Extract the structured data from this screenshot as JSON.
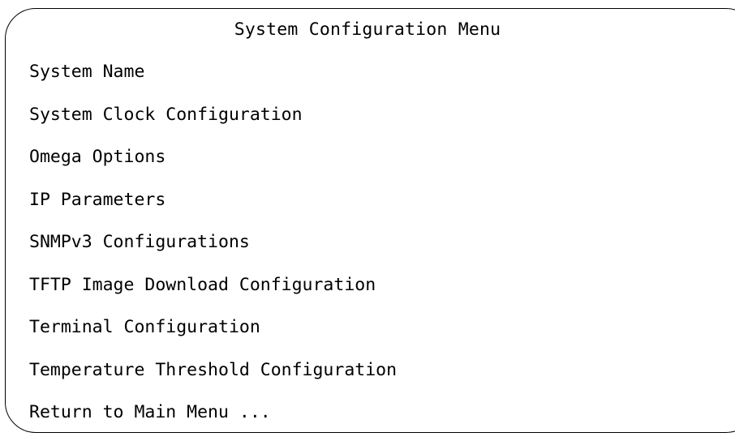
{
  "menu": {
    "title": "System Configuration Menu",
    "items": [
      {
        "label": "System Name"
      },
      {
        "label": "System Clock Configuration"
      },
      {
        "label": "Omega Options"
      },
      {
        "label": "IP Parameters"
      },
      {
        "label": "SNMPv3 Configurations"
      },
      {
        "label": "TFTP Image Download Configuration"
      },
      {
        "label": "Terminal Configuration"
      },
      {
        "label": "Temperature Threshold Configuration"
      },
      {
        "label": "Return to Main Menu ..."
      }
    ]
  }
}
